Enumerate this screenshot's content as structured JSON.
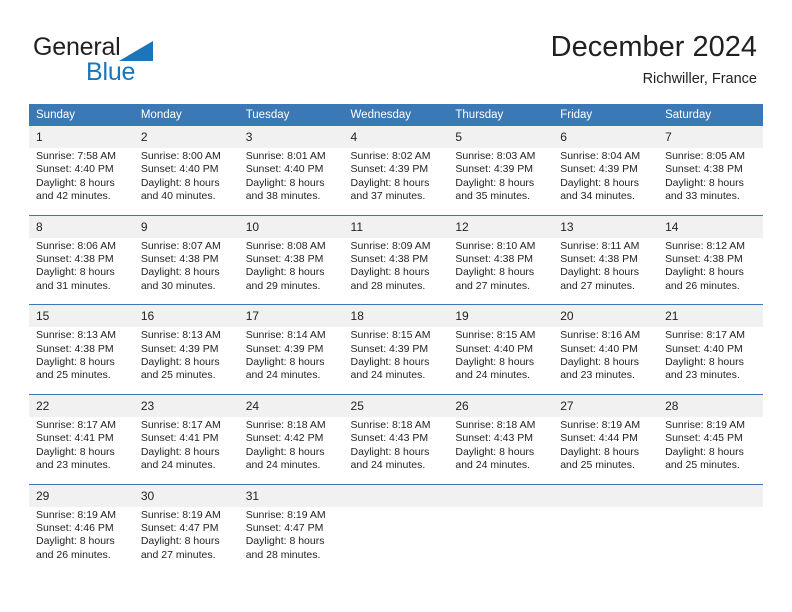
{
  "brand": {
    "line1": "General",
    "line2": "Blue",
    "mark": "triangle-mark",
    "accent_color": "#1b75bb"
  },
  "header": {
    "title": "December 2024",
    "subtitle": "Richwiller, France"
  },
  "calendar": {
    "header_color": "#3b78b6",
    "daynum_band_color": "#f1f1f1",
    "weekdays": [
      "Sunday",
      "Monday",
      "Tuesday",
      "Wednesday",
      "Thursday",
      "Friday",
      "Saturday"
    ],
    "weeks": [
      {
        "days": [
          {
            "num": "1",
            "sunrise": "Sunrise: 7:58 AM",
            "sunset": "Sunset: 4:40 PM",
            "daylight1": "Daylight: 8 hours",
            "daylight2": "and 42 minutes."
          },
          {
            "num": "2",
            "sunrise": "Sunrise: 8:00 AM",
            "sunset": "Sunset: 4:40 PM",
            "daylight1": "Daylight: 8 hours",
            "daylight2": "and 40 minutes."
          },
          {
            "num": "3",
            "sunrise": "Sunrise: 8:01 AM",
            "sunset": "Sunset: 4:40 PM",
            "daylight1": "Daylight: 8 hours",
            "daylight2": "and 38 minutes."
          },
          {
            "num": "4",
            "sunrise": "Sunrise: 8:02 AM",
            "sunset": "Sunset: 4:39 PM",
            "daylight1": "Daylight: 8 hours",
            "daylight2": "and 37 minutes."
          },
          {
            "num": "5",
            "sunrise": "Sunrise: 8:03 AM",
            "sunset": "Sunset: 4:39 PM",
            "daylight1": "Daylight: 8 hours",
            "daylight2": "and 35 minutes."
          },
          {
            "num": "6",
            "sunrise": "Sunrise: 8:04 AM",
            "sunset": "Sunset: 4:39 PM",
            "daylight1": "Daylight: 8 hours",
            "daylight2": "and 34 minutes."
          },
          {
            "num": "7",
            "sunrise": "Sunrise: 8:05 AM",
            "sunset": "Sunset: 4:38 PM",
            "daylight1": "Daylight: 8 hours",
            "daylight2": "and 33 minutes."
          }
        ]
      },
      {
        "days": [
          {
            "num": "8",
            "sunrise": "Sunrise: 8:06 AM",
            "sunset": "Sunset: 4:38 PM",
            "daylight1": "Daylight: 8 hours",
            "daylight2": "and 31 minutes."
          },
          {
            "num": "9",
            "sunrise": "Sunrise: 8:07 AM",
            "sunset": "Sunset: 4:38 PM",
            "daylight1": "Daylight: 8 hours",
            "daylight2": "and 30 minutes."
          },
          {
            "num": "10",
            "sunrise": "Sunrise: 8:08 AM",
            "sunset": "Sunset: 4:38 PM",
            "daylight1": "Daylight: 8 hours",
            "daylight2": "and 29 minutes."
          },
          {
            "num": "11",
            "sunrise": "Sunrise: 8:09 AM",
            "sunset": "Sunset: 4:38 PM",
            "daylight1": "Daylight: 8 hours",
            "daylight2": "and 28 minutes."
          },
          {
            "num": "12",
            "sunrise": "Sunrise: 8:10 AM",
            "sunset": "Sunset: 4:38 PM",
            "daylight1": "Daylight: 8 hours",
            "daylight2": "and 27 minutes."
          },
          {
            "num": "13",
            "sunrise": "Sunrise: 8:11 AM",
            "sunset": "Sunset: 4:38 PM",
            "daylight1": "Daylight: 8 hours",
            "daylight2": "and 27 minutes."
          },
          {
            "num": "14",
            "sunrise": "Sunrise: 8:12 AM",
            "sunset": "Sunset: 4:38 PM",
            "daylight1": "Daylight: 8 hours",
            "daylight2": "and 26 minutes."
          }
        ]
      },
      {
        "days": [
          {
            "num": "15",
            "sunrise": "Sunrise: 8:13 AM",
            "sunset": "Sunset: 4:38 PM",
            "daylight1": "Daylight: 8 hours",
            "daylight2": "and 25 minutes."
          },
          {
            "num": "16",
            "sunrise": "Sunrise: 8:13 AM",
            "sunset": "Sunset: 4:39 PM",
            "daylight1": "Daylight: 8 hours",
            "daylight2": "and 25 minutes."
          },
          {
            "num": "17",
            "sunrise": "Sunrise: 8:14 AM",
            "sunset": "Sunset: 4:39 PM",
            "daylight1": "Daylight: 8 hours",
            "daylight2": "and 24 minutes."
          },
          {
            "num": "18",
            "sunrise": "Sunrise: 8:15 AM",
            "sunset": "Sunset: 4:39 PM",
            "daylight1": "Daylight: 8 hours",
            "daylight2": "and 24 minutes."
          },
          {
            "num": "19",
            "sunrise": "Sunrise: 8:15 AM",
            "sunset": "Sunset: 4:40 PM",
            "daylight1": "Daylight: 8 hours",
            "daylight2": "and 24 minutes."
          },
          {
            "num": "20",
            "sunrise": "Sunrise: 8:16 AM",
            "sunset": "Sunset: 4:40 PM",
            "daylight1": "Daylight: 8 hours",
            "daylight2": "and 23 minutes."
          },
          {
            "num": "21",
            "sunrise": "Sunrise: 8:17 AM",
            "sunset": "Sunset: 4:40 PM",
            "daylight1": "Daylight: 8 hours",
            "daylight2": "and 23 minutes."
          }
        ]
      },
      {
        "days": [
          {
            "num": "22",
            "sunrise": "Sunrise: 8:17 AM",
            "sunset": "Sunset: 4:41 PM",
            "daylight1": "Daylight: 8 hours",
            "daylight2": "and 23 minutes."
          },
          {
            "num": "23",
            "sunrise": "Sunrise: 8:17 AM",
            "sunset": "Sunset: 4:41 PM",
            "daylight1": "Daylight: 8 hours",
            "daylight2": "and 24 minutes."
          },
          {
            "num": "24",
            "sunrise": "Sunrise: 8:18 AM",
            "sunset": "Sunset: 4:42 PM",
            "daylight1": "Daylight: 8 hours",
            "daylight2": "and 24 minutes."
          },
          {
            "num": "25",
            "sunrise": "Sunrise: 8:18 AM",
            "sunset": "Sunset: 4:43 PM",
            "daylight1": "Daylight: 8 hours",
            "daylight2": "and 24 minutes."
          },
          {
            "num": "26",
            "sunrise": "Sunrise: 8:18 AM",
            "sunset": "Sunset: 4:43 PM",
            "daylight1": "Daylight: 8 hours",
            "daylight2": "and 24 minutes."
          },
          {
            "num": "27",
            "sunrise": "Sunrise: 8:19 AM",
            "sunset": "Sunset: 4:44 PM",
            "daylight1": "Daylight: 8 hours",
            "daylight2": "and 25 minutes."
          },
          {
            "num": "28",
            "sunrise": "Sunrise: 8:19 AM",
            "sunset": "Sunset: 4:45 PM",
            "daylight1": "Daylight: 8 hours",
            "daylight2": "and 25 minutes."
          }
        ]
      },
      {
        "days": [
          {
            "num": "29",
            "sunrise": "Sunrise: 8:19 AM",
            "sunset": "Sunset: 4:46 PM",
            "daylight1": "Daylight: 8 hours",
            "daylight2": "and 26 minutes."
          },
          {
            "num": "30",
            "sunrise": "Sunrise: 8:19 AM",
            "sunset": "Sunset: 4:47 PM",
            "daylight1": "Daylight: 8 hours",
            "daylight2": "and 27 minutes."
          },
          {
            "num": "31",
            "sunrise": "Sunrise: 8:19 AM",
            "sunset": "Sunset: 4:47 PM",
            "daylight1": "Daylight: 8 hours",
            "daylight2": "and 28 minutes."
          },
          {
            "num": "",
            "sunrise": "",
            "sunset": "",
            "daylight1": "",
            "daylight2": ""
          },
          {
            "num": "",
            "sunrise": "",
            "sunset": "",
            "daylight1": "",
            "daylight2": ""
          },
          {
            "num": "",
            "sunrise": "",
            "sunset": "",
            "daylight1": "",
            "daylight2": ""
          },
          {
            "num": "",
            "sunrise": "",
            "sunset": "",
            "daylight1": "",
            "daylight2": ""
          }
        ]
      }
    ]
  }
}
